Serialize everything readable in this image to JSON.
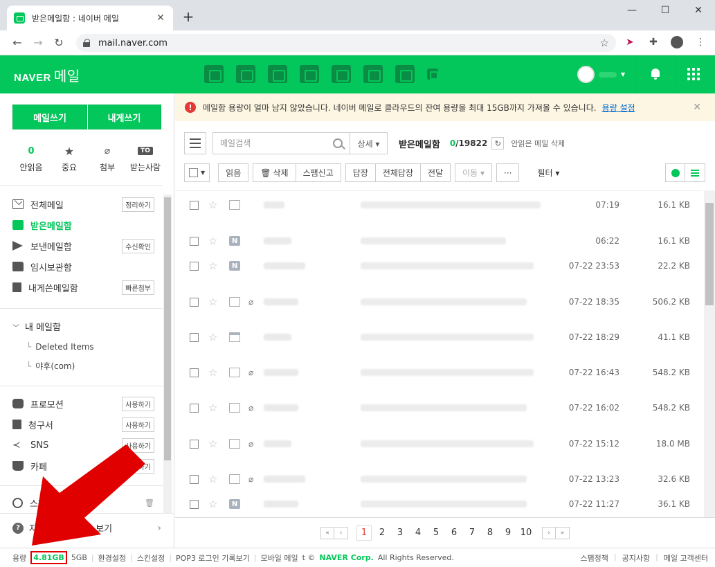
{
  "browser": {
    "tab_title": "받은메일함 : 네이버 메일",
    "url": "mail.naver.com",
    "new_tab": "+",
    "min": "—",
    "max": "☐",
    "close": "✕"
  },
  "header": {
    "logo": "NAVER",
    "product": "메일"
  },
  "sidebar": {
    "write_mail": "메일쓰기",
    "write_self": "내게쓰기",
    "quick": [
      {
        "count": "0",
        "label": "안읽음"
      },
      {
        "label": "중요"
      },
      {
        "label": "첨부"
      },
      {
        "badge": "TO",
        "label": "받는사람"
      }
    ],
    "folders": [
      {
        "label": "전체메일",
        "button": "정리하기"
      },
      {
        "label": "받은메일함"
      },
      {
        "label": "보낸메일함",
        "button": "수신확인"
      },
      {
        "label": "임시보관함"
      },
      {
        "label": "내게쓴메일함",
        "button": "빠른첨부"
      }
    ],
    "my_mailbox": "내 메일함",
    "sub_folders": [
      "Deleted Items",
      "야후(com)"
    ],
    "extras": [
      {
        "label": "프로모션",
        "button": "사용하기"
      },
      {
        "label": "청구서",
        "button": "사용하기"
      },
      {
        "label": "SNS",
        "button": "사용하기"
      },
      {
        "label": "카페",
        "button": "사용하기"
      }
    ],
    "spam": "스팸메일함",
    "faq": "자주 찾는 도움말 보기"
  },
  "notice": {
    "text": "메일함 용량이 얼마 남지 않았습니다. 네이버 메일로 클라우드의 잔여 용량을 최대 15GB까지 가져올 수 있습니다.",
    "link": "용량 설정"
  },
  "search": {
    "placeholder": "메일검색",
    "detail": "상세 ▾"
  },
  "mailbox": {
    "title": "받은메일함",
    "unread": "0",
    "total": "/19822",
    "safe_delete": "안읽은 메일 삭제"
  },
  "actions": {
    "read": "읽음",
    "delete": "삭제",
    "spam": "스팸신고",
    "reply": "답장",
    "reply_all": "전체답장",
    "forward": "전달",
    "move": "이동 ▾",
    "more": "···",
    "filter": "필터 ▾"
  },
  "mails": [
    {
      "type": "env",
      "clip": false,
      "time": "07:19",
      "size": "16.1 KB"
    },
    {
      "type": "n",
      "clip": false,
      "time": "06:22",
      "size": "16.1 KB"
    },
    {
      "type": "n",
      "clip": false,
      "time": "07-22 23:53",
      "size": "22.2 KB"
    },
    {
      "type": "env",
      "clip": true,
      "time": "07-22 18:35",
      "size": "506.2 KB"
    },
    {
      "type": "box",
      "clip": false,
      "time": "07-22 18:29",
      "size": "41.1 KB"
    },
    {
      "type": "env",
      "clip": true,
      "time": "07-22 16:43",
      "size": "548.2 KB"
    },
    {
      "type": "env",
      "clip": true,
      "time": "07-22 16:02",
      "size": "548.2 KB"
    },
    {
      "type": "env",
      "clip": true,
      "time": "07-22 15:12",
      "size": "18.0 MB"
    },
    {
      "type": "env",
      "clip": true,
      "time": "07-22 13:23",
      "size": "32.6 KB"
    },
    {
      "type": "n",
      "clip": false,
      "time": "07-22 11:27",
      "size": "36.1 KB"
    }
  ],
  "pager": {
    "pages": [
      "1",
      "2",
      "3",
      "4",
      "5",
      "6",
      "7",
      "8",
      "9",
      "10"
    ],
    "current": "1"
  },
  "footer": {
    "capacity_label": "용량",
    "used": "4.81GB",
    "total": "5GB",
    "links": [
      "환경설정",
      "스킨설정",
      "POP3 로그인 기록보기",
      "모바일 메일"
    ],
    "copyright_prefix": "t ©",
    "brand": "NAVER Corp.",
    "rights": "All Rights Reserved.",
    "right_links": [
      "스팸정책",
      "공지사항",
      "메일 고객센터"
    ]
  },
  "colors": {
    "brand": "#03c75a",
    "annotation": "#e00000"
  }
}
